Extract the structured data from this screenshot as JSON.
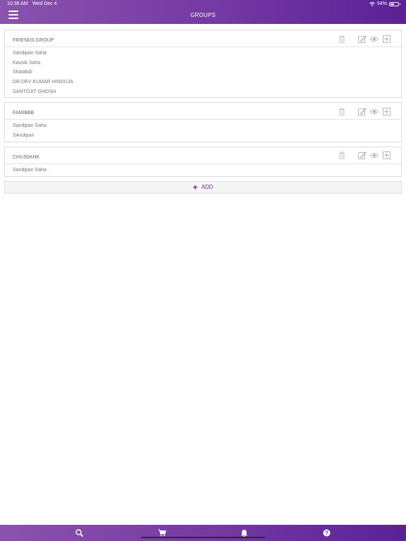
{
  "status": {
    "time": "10:38 AM",
    "date": "Wed Dec 4",
    "battery": "54%",
    "battery_level": 0.54
  },
  "header": {
    "title": "GROUPS"
  },
  "groups": [
    {
      "name": "FRIENDS GROUP",
      "members": [
        "Sandipan Saha",
        "Kausik Saha",
        "Shatabdi",
        "DR DEV KUMAR HINDUJA",
        "SANTOJIT GHOSH"
      ]
    },
    {
      "name": "FAMIBBB",
      "members": [
        "Sandipan Saha",
        "SAndipan"
      ]
    },
    {
      "name": "CHVJGKHK",
      "members": [
        "Sandipan Saha"
      ]
    }
  ],
  "actions": {
    "add_label": "ADD"
  },
  "icons": {
    "menu": "hamburger-menu-icon",
    "trash": "trash-icon",
    "edit": "edit-icon",
    "view": "eye-icon",
    "add_member": "plus-square-icon",
    "search": "search-icon",
    "cart": "cart-icon",
    "bell": "bell-icon",
    "help": "help-icon"
  },
  "colors": {
    "brand": "#7438a3",
    "accent": "#6b2e98"
  }
}
